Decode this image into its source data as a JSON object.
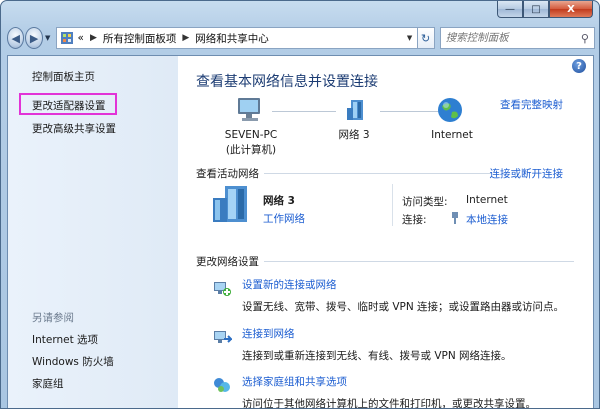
{
  "window": {
    "controls": {
      "minimize": "—",
      "maximize": "□",
      "close": "X"
    }
  },
  "nav": {
    "back_icon": "back-arrow-icon",
    "forward_icon": "forward-arrow-icon",
    "address_prefix": "«",
    "breadcrumb": [
      "所有控制面板项",
      "网络和共享中心"
    ],
    "search_placeholder": "搜索控制面板"
  },
  "sidebar": {
    "items": [
      {
        "label": "控制面板主页"
      },
      {
        "label": "更改适配器设置"
      },
      {
        "label": "更改高级共享设置"
      }
    ],
    "see_also_title": "另请参阅",
    "see_also": [
      {
        "label": "Internet 选项"
      },
      {
        "label": "Windows 防火墙"
      },
      {
        "label": "家庭组"
      }
    ]
  },
  "main": {
    "title": "查看基本网络信息并设置连接",
    "view_full_map": "查看完整映射",
    "nodes": [
      {
        "name": "SEVEN-PC",
        "sub": "(此计算机)"
      },
      {
        "name": "网络  3",
        "sub": ""
      },
      {
        "name": "Internet",
        "sub": ""
      }
    ],
    "active_header": "查看活动网络",
    "connect_disconnect": "连接或断开连接",
    "active_network": {
      "name": "网络  3",
      "type_link": "工作网络",
      "access_label": "访问类型:",
      "access_value": "Internet",
      "conn_label": "连接:",
      "conn_value": "本地连接"
    },
    "change_header": "更改网络设置",
    "tasks": [
      {
        "title": "设置新的连接或网络",
        "desc": "设置无线、宽带、拨号、临时或 VPN 连接；或设置路由器或访问点。"
      },
      {
        "title": "连接到网络",
        "desc": "连接到或重新连接到无线、有线、拨号或 VPN 网络连接。"
      },
      {
        "title": "选择家庭组和共享选项",
        "desc": "访问位于其他网络计算机上的文件和打印机，或更改共享设置。"
      }
    ]
  },
  "colors": {
    "link": "#1d5ed1",
    "title": "#1c3c73",
    "highlight": "#e233d7"
  }
}
